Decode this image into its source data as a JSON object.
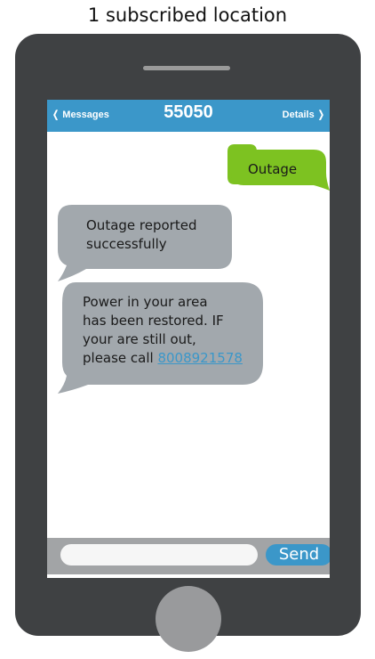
{
  "caption": "1 subscribed location",
  "nav": {
    "back_label": "Messages",
    "title": "55050",
    "details_label": "Details"
  },
  "messages": [
    {
      "direction": "outgoing",
      "text": "Outage"
    },
    {
      "direction": "incoming",
      "lines": [
        "Outage reported",
        "successfully"
      ]
    },
    {
      "direction": "incoming",
      "lines": [
        "Power in your area",
        "has been restored. IF",
        "your are still out,"
      ],
      "last_line_prefix": "please call ",
      "phone_link": "8008921578"
    }
  ],
  "input": {
    "value": "",
    "placeholder": ""
  },
  "send_label": "Send",
  "colors": {
    "phone_body": "#3f4143",
    "nav_blue": "#3b97c9",
    "outgoing_bubble": "#7dc221",
    "incoming_bubble": "#a2a8ad",
    "input_bar": "#a2a4a6"
  }
}
